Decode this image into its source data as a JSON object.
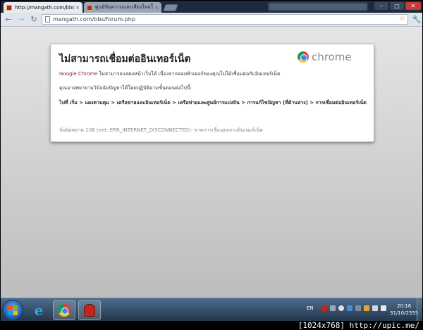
{
  "browser": {
    "tabs": [
      {
        "title": "http://mangath.com/bbs/f",
        "active": true
      },
      {
        "title": "ศูนย์ข้อความและเสียงใหม่ใช้",
        "active": false
      }
    ],
    "address": "mangath.com/bbs/forum.php",
    "icons": {
      "back": "back-arrow-icon",
      "forward": "forward-arrow-icon",
      "reload": "reload-icon",
      "star": "bookmark-star-icon",
      "wrench": "wrench-icon"
    }
  },
  "error_page": {
    "title": "ไม่สามารถเชื่อมต่ออินเทอร์เน็ต",
    "logo_text": "chrome",
    "brand": "Google Chrome",
    "description": "ไม่สามารถแสดงหน้าเว็บได้ เนื่องจากคอมพิวเตอร์ของคุณไม่ได้เชื่อมต่อกับอินเทอร์เน็ต",
    "try_text": "คุณอาจพยายามวินิจฉัยปัญหาได้โดยปฏิบัติตามขั้นตอนต่อไปนี้:",
    "path_text": "ไปที่ เริ่ม > แผงควบคุม > เครือข่ายและอินเทอร์เน็ต > เครือข่ายและศูนย์การแบ่งปัน > การแก้ไขปัญหา (ที่ด้านล่าง) > การเชื่อมต่ออินเทอร์เน็ต",
    "error_code": "ข้อผิดพลาด 106 (net::ERR_INTERNET_DISCONNECTED): ขาดการเชื่อมต่อทางอินเทอร์เน็ต"
  },
  "taskbar": {
    "language": "EN",
    "time": "20:16",
    "date": "31/10/2555"
  },
  "watermark": "[1024x768] http://upic.me/",
  "colors": {
    "tab_strip": "#1b2a3f",
    "page_bg": "#d2d2d2",
    "taskbar": "#34506d",
    "close": "#c43c36"
  }
}
